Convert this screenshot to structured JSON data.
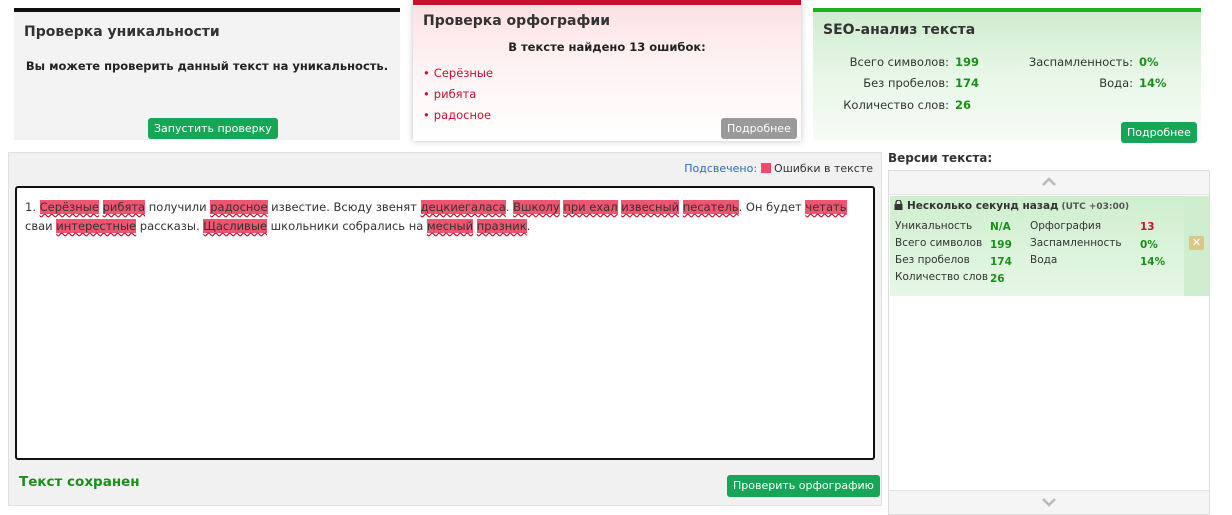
{
  "uniqueness": {
    "title": "Проверка уникальности",
    "text": "Вы можете проверить данный текст на уникальность.",
    "button": "Запустить проверку"
  },
  "spelling": {
    "title": "Проверка орфографии",
    "found_text": "В тексте найдено 13 ошибок:",
    "errors": [
      "Серёзные",
      "рибята",
      "радосное"
    ],
    "button": "Подробнее"
  },
  "seo": {
    "title": "SEO-анализ текста",
    "total_chars_label": "Всего символов:",
    "total_chars": "199",
    "no_spaces_label": "Без пробелов:",
    "no_spaces": "174",
    "word_count_label": "Количество слов:",
    "word_count": "26",
    "spam_label": "Заспамленность:",
    "spam": "0%",
    "water_label": "Вода:",
    "water": "14%",
    "button": "Подробнее"
  },
  "editor": {
    "legend_label": "Подсвечено:",
    "legend_text": "Ошибки в тексте",
    "segments": [
      {
        "t": "1. ",
        "e": false
      },
      {
        "t": "Серёзные",
        "e": true
      },
      {
        "t": " ",
        "e": false
      },
      {
        "t": "рибята",
        "e": true
      },
      {
        "t": " получили ",
        "e": false
      },
      {
        "t": "радосное",
        "e": true
      },
      {
        "t": " известие. Всюду звенят ",
        "e": false
      },
      {
        "t": "децкиегаласа",
        "e": true
      },
      {
        "t": ". ",
        "e": false
      },
      {
        "t": "Вшколу",
        "e": true
      },
      {
        "t": " ",
        "e": false
      },
      {
        "t": "при ехал",
        "e": true
      },
      {
        "t": " ",
        "e": false
      },
      {
        "t": "извесный",
        "e": true
      },
      {
        "t": " ",
        "e": false
      },
      {
        "t": "песатель",
        "e": true
      },
      {
        "t": ". Он будет ",
        "e": false
      },
      {
        "t": "четать",
        "e": true
      },
      {
        "t": " сваи ",
        "e": false
      },
      {
        "t": "интерестные",
        "e": true
      },
      {
        "t": " рассказы. ",
        "e": false
      },
      {
        "t": "Щасливые",
        "e": true
      },
      {
        "t": " школьники собрались на ",
        "e": false
      },
      {
        "t": "месный",
        "e": true
      },
      {
        "t": " ",
        "e": false
      },
      {
        "t": "празник",
        "e": true
      },
      {
        "t": ".",
        "e": false
      }
    ],
    "saved_text": "Текст сохранен",
    "check_button": "Проверить орфографию"
  },
  "versions": {
    "title": "Версии текста:",
    "item": {
      "time": "Несколько секунд назад",
      "timezone": "(UTC +03:00)",
      "uniq_label": "Уникальность",
      "uniq": "N/A",
      "total_label": "Всего символов",
      "total": "199",
      "nospace_label": "Без пробелов",
      "nospace": "174",
      "words_label": "Количество слов",
      "words": "26",
      "spell_label": "Орфография",
      "spell": "13",
      "spam_label": "Заспамленность",
      "spam": "0%",
      "water_label": "Вода",
      "water": "14%"
    },
    "delete_symbol": "✕"
  },
  "colors": {
    "error_highlight": "#ef5470",
    "accent_green": "#17a558",
    "accent_red": "#c8102e"
  }
}
